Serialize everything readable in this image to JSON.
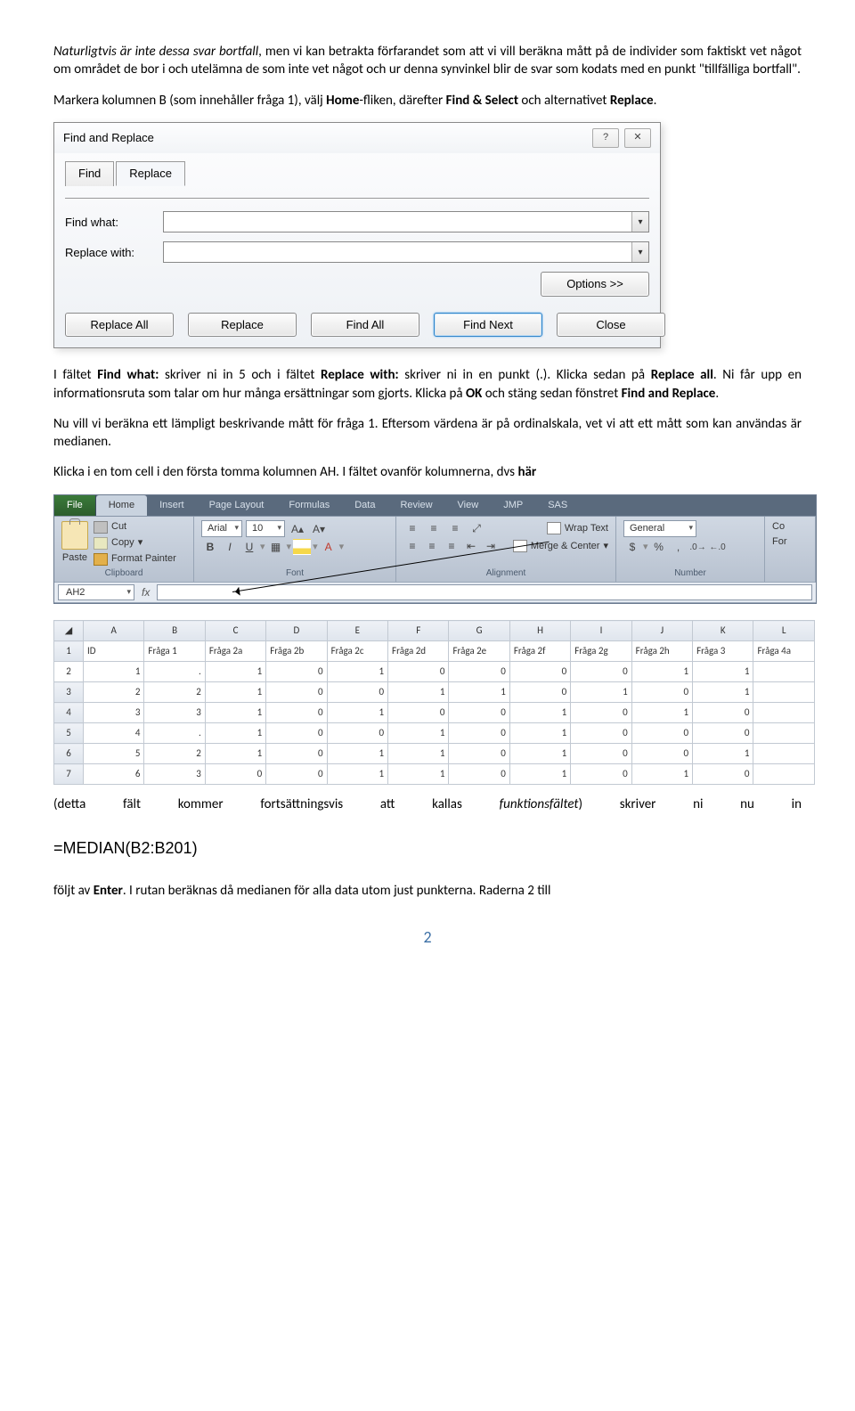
{
  "para1_pre": "Naturligtvis är inte dessa svar bortfall",
  "para1_post": ", men vi kan betrakta förfarandet som att vi vill beräkna mått på de individer som faktiskt vet något om området de bor i och utelämna de som inte vet något och ur denna synvinkel blir de svar som kodats med en punkt \"tillfälliga bortfall\".",
  "para2_a": "Markera kolumnen B (som innehåller fråga 1), välj ",
  "para2_b": "Home",
  "para2_c": "-fliken, därefter ",
  "para2_d": "Find & Select",
  "para2_e": " och alternativet ",
  "para2_f": "Replace",
  "para2_g": ".",
  "dialog": {
    "title": "Find and Replace",
    "tab_find": "Find",
    "tab_replace": "Replace",
    "find_what": "Find what:",
    "replace_with": "Replace with:",
    "options": "Options >>",
    "btn_replace_all": "Replace All",
    "btn_replace": "Replace",
    "btn_find_all": "Find All",
    "btn_find_next": "Find Next",
    "btn_close": "Close",
    "help": "?",
    "close_x": "✕"
  },
  "para3_a": "I fältet ",
  "para3_b": "Find what:",
  "para3_c": " skriver ni in 5 och i fältet ",
  "para3_d": "Replace with:",
  "para3_e": " skriver ni in en punkt (.). Klicka sedan på ",
  "para3_f": "Replace all",
  "para3_g": ". Ni får upp en informationsruta som talar om hur många ersättningar som gjorts. Klicka på ",
  "para3_h": "OK",
  "para3_i": " och stäng sedan fönstret ",
  "para3_j": "Find and Replace",
  "para3_k": ".",
  "para4": "Nu vill vi beräkna ett lämpligt beskrivande mått för fråga 1. Eftersom värdena är på ordinalskala, vet vi att ett mått som kan användas är medianen.",
  "para5_a": "Klicka i en tom cell i den första tomma kolumnen AH. I fältet ovanför kolumnerna, dvs ",
  "para5_b": "här",
  "ribbon": {
    "tabs": [
      "File",
      "Home",
      "Insert",
      "Page Layout",
      "Formulas",
      "Data",
      "Review",
      "View",
      "JMP",
      "SAS"
    ],
    "cut": "Cut",
    "copy": "Copy",
    "format_painter": "Format Painter",
    "paste": "Paste",
    "clipboard": "Clipboard",
    "font_name": "Arial",
    "font_size": "10",
    "font_group": "Font",
    "wrap": "Wrap Text",
    "merge": "Merge & Center",
    "alignment": "Alignment",
    "number_format": "General",
    "number": "Number",
    "co": "Co",
    "for": "For",
    "name_box": "AH2",
    "fx": "fx"
  },
  "grid": {
    "cols": [
      "",
      "A",
      "B",
      "C",
      "D",
      "E",
      "F",
      "G",
      "H",
      "I",
      "J",
      "K",
      "L"
    ],
    "headers": [
      "",
      "ID",
      "Fråga 1",
      "Fråga 2a",
      "Fråga 2b",
      "Fråga 2c",
      "Fråga 2d",
      "Fråga 2e",
      "Fråga 2f",
      "Fråga 2g",
      "Fråga 2h",
      "Fråga 3",
      "Fråga 4a"
    ],
    "rows": [
      [
        "2",
        "1",
        ".",
        "1",
        "0",
        "1",
        "0",
        "0",
        "0",
        "0",
        "1",
        "1"
      ],
      [
        "3",
        "2",
        "2",
        "1",
        "0",
        "0",
        "1",
        "1",
        "0",
        "1",
        "0",
        "1"
      ],
      [
        "4",
        "3",
        "3",
        "1",
        "0",
        "1",
        "0",
        "0",
        "1",
        "0",
        "1",
        "0"
      ],
      [
        "5",
        "4",
        ".",
        "1",
        "0",
        "0",
        "1",
        "0",
        "1",
        "0",
        "0",
        "0"
      ],
      [
        "6",
        "5",
        "2",
        "1",
        "0",
        "1",
        "1",
        "0",
        "1",
        "0",
        "0",
        "1"
      ],
      [
        "7",
        "6",
        "3",
        "0",
        "0",
        "1",
        "1",
        "0",
        "1",
        "0",
        "1",
        "0"
      ]
    ]
  },
  "para6_a": "(detta fält kommer fortsättningsvis att kallas ",
  "para6_b": "funktionsfältet",
  "para6_c": ") skriver ni nu in",
  "formula": "=MEDIAN(B2:B201)",
  "para7_a": "följt av ",
  "para7_b": "Enter",
  "para7_c": ". I rutan beräknas då medianen för alla data utom just punkterna. Raderna 2 till",
  "page_number": "2"
}
